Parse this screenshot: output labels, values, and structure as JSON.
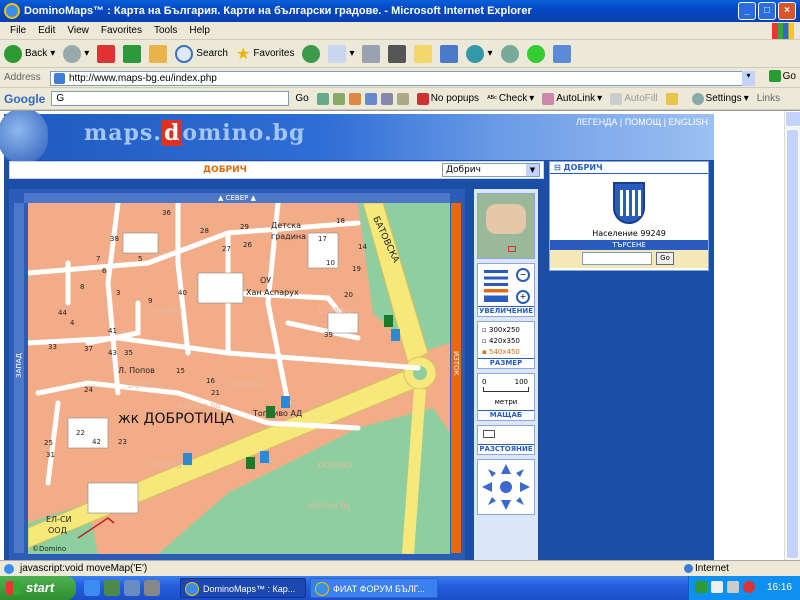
{
  "window": {
    "title": "DominoMaps™ : Карта на България. Карти на български градове. - Microsoft Internet Explorer"
  },
  "menu": [
    "File",
    "Edit",
    "View",
    "Favorites",
    "Tools",
    "Help"
  ],
  "toolbar": {
    "back_label": "Back",
    "search_label": "Search",
    "favorites_label": "Favorites"
  },
  "address": {
    "label": "Address",
    "url": "http://www.maps-bg.eu/index.php",
    "go_label": "Go"
  },
  "googlebar": {
    "logo": "Google",
    "field_value": "G",
    "go_label": "Go",
    "popups_label": "No popups",
    "check_label": "Check",
    "autolink_label": "AutoLink",
    "autofill_label": "AutoFill",
    "settings_label": "Settings",
    "links_label": "Links"
  },
  "site": {
    "logo_pre": "maps.",
    "logo_hl": "d",
    "logo_post": "omino.bg",
    "top_links": "ЛЕГЕНДА | ПОМОЩ | ENGLISH",
    "city_title": "ДОБРИЧ",
    "city_select_value": "Добрич",
    "nav_north": "СЕВЕР",
    "nav_west": "ЗАПАД",
    "nav_east": "ИЗТОК"
  },
  "map": {
    "district_label": "жк ДОБРОТИЦА",
    "street_batovska": "БАТОВСКА",
    "street_popov": "Л. Попов",
    "school": "ОУ\nХан Аспарух",
    "kindergarten": "Детска\nградина",
    "gas_station": "Топливо АД",
    "company": "ЕЛ-СИ\nООД",
    "copyright": "©Domino",
    "watermark": "DOMINO",
    "watermark_small": "domino.bg",
    "building_numbers": [
      "36",
      "38",
      "28",
      "29",
      "26",
      "27",
      "7",
      "6",
      "5",
      "8",
      "3",
      "40",
      "9",
      "44",
      "4",
      "41",
      "33",
      "37",
      "43",
      "35",
      "24",
      "22",
      "25",
      "31",
      "42",
      "23",
      "15",
      "16",
      "21",
      "20",
      "19",
      "10",
      "17",
      "18",
      "39",
      "14"
    ]
  },
  "side_tools": {
    "zoom_label": "УВЕЛИЧЕНИЕ",
    "size_label": "РАЗМЕР",
    "size_options": [
      "300x250",
      "420x350",
      "540x450"
    ],
    "size_selected": "540x450",
    "scale_label": "МАЩАБ",
    "scale_value": "100",
    "scale_zero": "0",
    "scale_unit": "метри",
    "distance_label": "РАЗСТОЯНИЕ"
  },
  "info": {
    "city_header": "ДОБРИЧ",
    "population": "Население 99249",
    "search_header": "ТЪРСЕНЕ",
    "search_go": "Go"
  },
  "statusbar": {
    "text": "javascript:void moveMap('E')",
    "zone": "Internet"
  },
  "taskbar": {
    "start_label": "start",
    "tasks": [
      "DominoMaps™ : Кар...",
      "ФИАТ ФОРУМ БЪЛГ..."
    ],
    "clock": "16:16"
  },
  "colors": {
    "accent": "#1b4fa5",
    "map_land": "#f2ad88",
    "map_park": "#8fcf9f",
    "map_road": "#f6e87a",
    "label_orange": "#e06a10"
  }
}
